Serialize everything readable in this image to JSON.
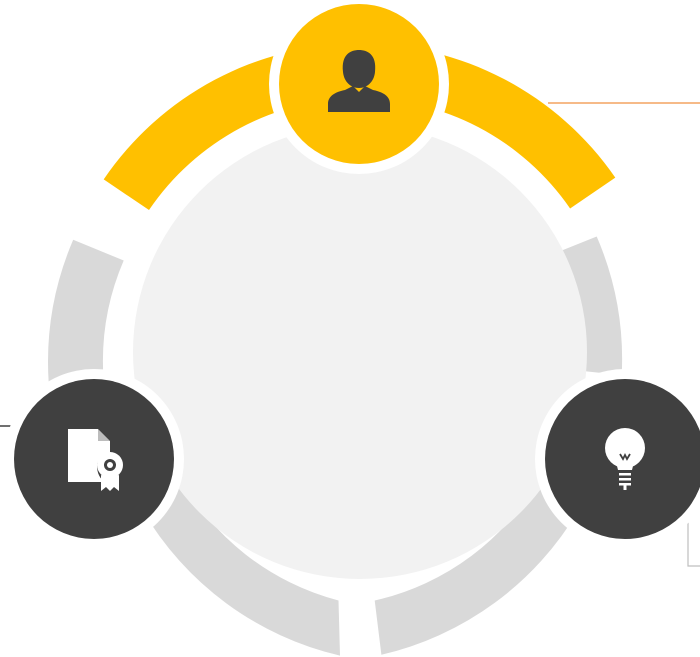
{
  "diagram": {
    "colors": {
      "accent": "#FFC000",
      "muted": "#D9D9D9",
      "dark": "#404040",
      "center": "#F2F2F2",
      "background": "#FFFFFF",
      "leader_orange": "#F4A460",
      "leader_dark": "#404040",
      "leader_gray": "#BFBFBF"
    },
    "nodes": [
      {
        "id": "person",
        "icon": "person-icon",
        "fill": "accent"
      },
      {
        "id": "certificate",
        "icon": "certificate-icon",
        "fill": "dark"
      },
      {
        "id": "idea",
        "icon": "lightbulb-icon",
        "fill": "dark"
      }
    ],
    "ring_segments": [
      {
        "id": "top",
        "fill": "accent"
      },
      {
        "id": "right",
        "fill": "muted"
      },
      {
        "id": "bottom-right",
        "fill": "muted"
      },
      {
        "id": "bottom-left",
        "fill": "muted"
      },
      {
        "id": "left",
        "fill": "muted"
      }
    ]
  }
}
